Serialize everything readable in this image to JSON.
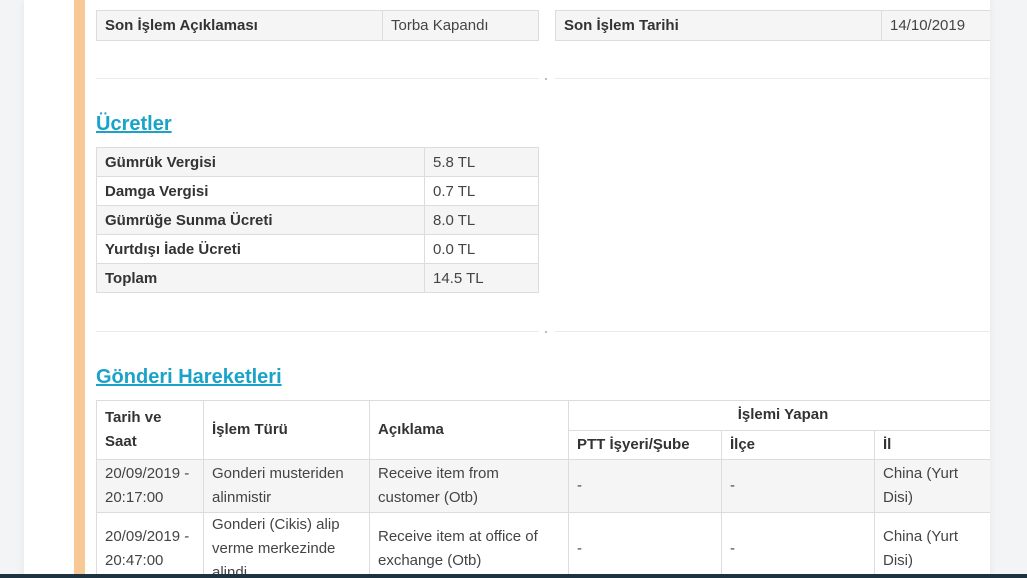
{
  "last_transaction": {
    "description_label": "Son İşlem Açıklaması",
    "description_value": "Torba Kapandı",
    "date_label": "Son İşlem Tarihi",
    "date_value": "14/10/2019"
  },
  "fees": {
    "title": "Ücretler",
    "rows": [
      {
        "label": "Gümrük Vergisi",
        "value": "5.8 TL"
      },
      {
        "label": "Damga Vergisi",
        "value": "0.7 TL"
      },
      {
        "label": "Gümrüğe Sunma Ücreti",
        "value": "8.0 TL"
      },
      {
        "label": "Yurtdışı İade Ücreti",
        "value": "0.0 TL"
      },
      {
        "label": "Toplam",
        "value": "14.5 TL"
      }
    ]
  },
  "movements": {
    "title": "Gönderi Hareketleri",
    "headers": {
      "date_time": "Tarih ve Saat",
      "transaction_type": "İşlem Türü",
      "description": "Açıklama",
      "performed_by": "İşlemi Yapan",
      "office": "PTT İşyeri/Şube",
      "district": "İlçe",
      "province": "İl"
    },
    "rows": [
      {
        "date_time": "20/09/2019 - 20:17:00",
        "transaction_type": "Gonderi musteriden alinmistir",
        "description": "Receive item from customer (Otb)",
        "office": "-",
        "district": "-",
        "province": "China (Yurt Disi)"
      },
      {
        "date_time": "20/09/2019 - 20:47:00",
        "transaction_type": "Gonderi (Cikis) alip verme merkezinde alindi",
        "description": "Receive item at office of exchange (Otb)",
        "office": "-",
        "district": "-",
        "province": "China (Yurt Disi)"
      }
    ]
  },
  "colors": {
    "accent_bar": "#f8c995",
    "section_title": "#1aa3c8",
    "bottom_bar": "#1d3440"
  }
}
